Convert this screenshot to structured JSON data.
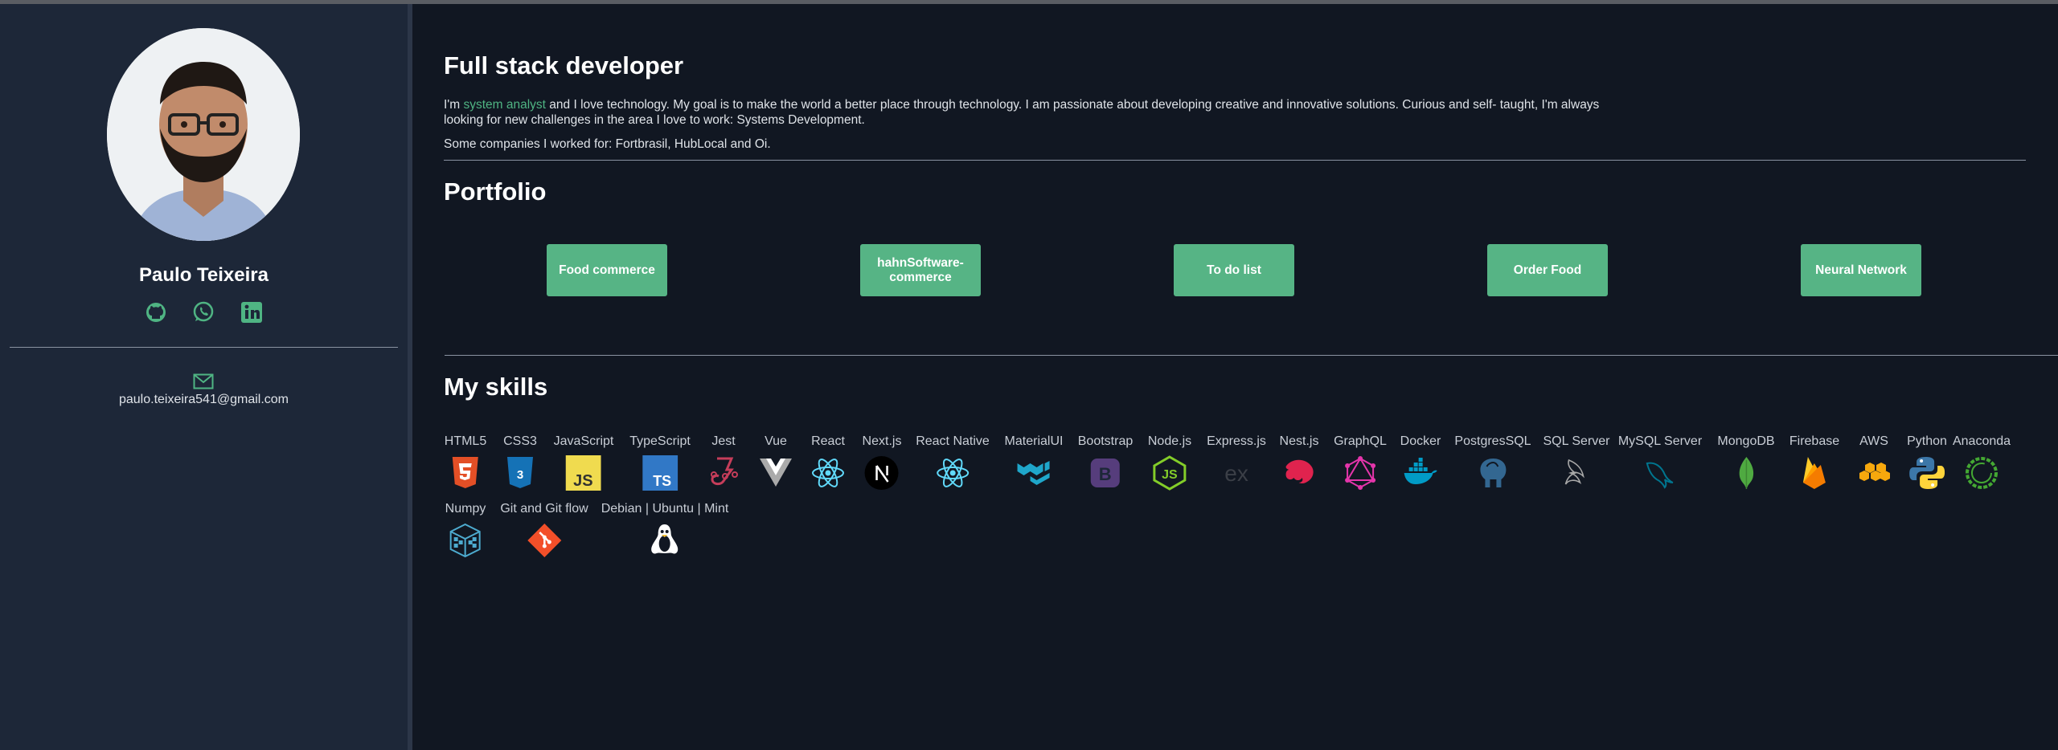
{
  "sidebar": {
    "name": "Paulo Teixeira",
    "email": "paulo.teixeira541@gmail.com",
    "social_icons": [
      "github-icon",
      "whatsapp-icon",
      "linkedin-icon"
    ]
  },
  "about": {
    "title": "Full stack developer",
    "intro_pre": "I'm ",
    "intro_accent": "system analyst",
    "intro_post": " and I love technology. My goal is to make the world a better place through technology. I am passionate about developing creative and innovative solutions. Curious and self- taught, I'm always looking for new challenges in the area I love to work: Systems Development.",
    "companies": "Some companies I worked for: Fortbrasil, HubLocal and Oi."
  },
  "portfolio": {
    "title": "Portfolio",
    "buttons": [
      "Food commerce",
      "hahnSoftware-commerce",
      "To do list",
      "Order Food",
      "Neural Network"
    ]
  },
  "skills": {
    "title": "My skills",
    "items": [
      "HTML5",
      "CSS3",
      "JavaScript",
      "TypeScript",
      "Jest",
      "Vue",
      "React",
      "Next.js",
      "React Native",
      "MaterialUI",
      "Bootstrap",
      "Node.js",
      "Express.js",
      "Nest.js",
      "GraphQL",
      "Docker",
      "PostgresSQL",
      "SQL Server",
      "MySQL Server",
      "MongoDB",
      "Firebase",
      "AWS",
      "Python",
      "Anaconda",
      "Numpy",
      "Git and Git flow",
      "Debian | Ubuntu | Mint"
    ]
  },
  "colors": {
    "accent": "#56b485",
    "background": "#111722",
    "sidebar": "#1d2738"
  }
}
